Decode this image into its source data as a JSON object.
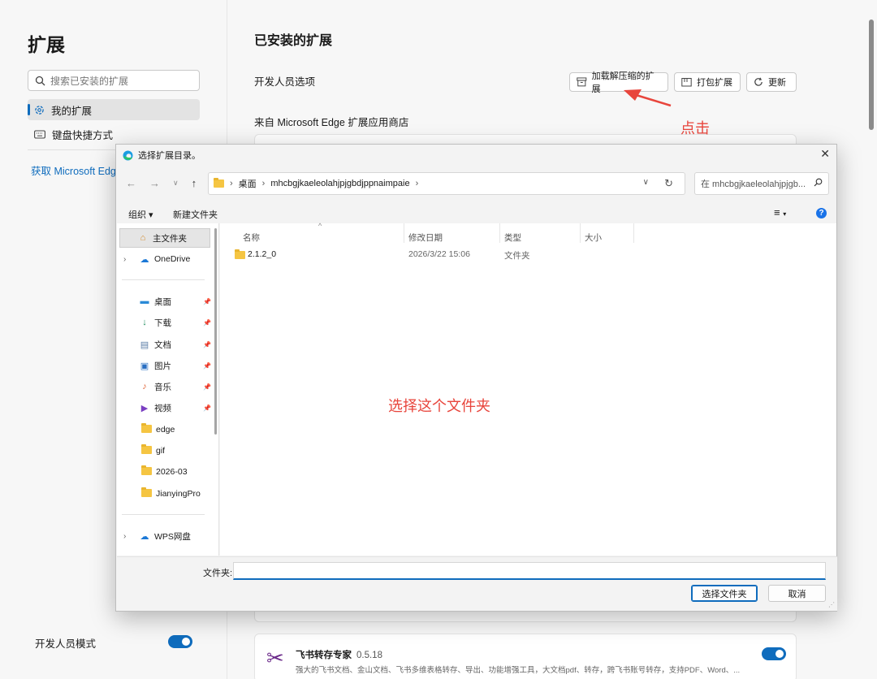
{
  "sidebar": {
    "title": "扩展",
    "search_placeholder": "搜索已安装的扩展",
    "items": [
      {
        "label": "我的扩展",
        "icon": "gear-icon"
      },
      {
        "label": "键盘快捷方式",
        "icon": "keyboard-icon"
      }
    ],
    "get_link": "获取 Microsoft Edge",
    "dev_mode_label": "开发人员模式",
    "dev_mode_on": true
  },
  "main": {
    "title": "已安装的扩展",
    "dev_options_label": "开发人员选项",
    "buttons": {
      "load_unpacked": "加载解压缩的扩展",
      "pack": "打包扩展",
      "update": "更新"
    },
    "store_label": "来自 Microsoft Edge 扩展应用商店",
    "extension": {
      "name": "飞书转存专家",
      "version": "0.5.18",
      "description": "强大的飞书文档、金山文档、飞书多维表格转存、导出、功能增强工具，大文档pdf、转存，跨飞书账号转存，支持PDF、Word、...",
      "enabled": true
    }
  },
  "annotations": {
    "click": "点击",
    "select_folder": "选择这个文件夹"
  },
  "dialog": {
    "title": "选择扩展目录。",
    "breadcrumb": [
      "桌面",
      "mhcbgjkaeleolahjpjgbdjppnaimpaie"
    ],
    "search_placeholder": "在 mhcbgjkaeleolahjpjgb...",
    "cmd": {
      "organize": "组织 ▾",
      "new_folder": "新建文件夹"
    },
    "nav_items": {
      "home": "主文件夹",
      "onedrive": "OneDrive",
      "desktop": "桌面",
      "downloads": "下载",
      "documents": "文档",
      "pictures": "图片",
      "music": "音乐",
      "videos": "视频",
      "edge": "edge",
      "gif": "gif",
      "d2026": "2026-03",
      "jianying": "JianyingPro",
      "wps": "WPS网盘"
    },
    "columns": {
      "name": "名称",
      "modified": "修改日期",
      "type": "类型",
      "size": "大小"
    },
    "files": [
      {
        "name": "2.1.2_0",
        "modified": "2026/3/22 15:06",
        "type": "文件夹",
        "size": ""
      }
    ],
    "folder_label": "文件夹:",
    "folder_value": "",
    "select_button": "选择文件夹",
    "cancel_button": "取消"
  }
}
